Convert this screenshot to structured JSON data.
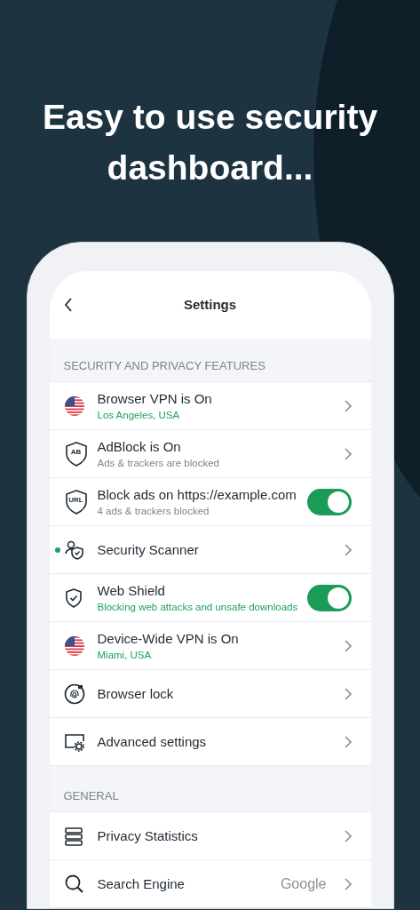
{
  "headline": "Easy to use security dashboard...",
  "screen": {
    "title": "Settings",
    "sections": [
      {
        "heading": "SECURITY AND PRIVACY FEATURES",
        "rows": [
          {
            "kind": "chevron",
            "title": "Browser VPN is On",
            "subtitle": "Los Angeles, USA",
            "accent": true,
            "dot": false
          },
          {
            "kind": "chevron",
            "icon_text": "AB",
            "title": "AdBlock is On",
            "subtitle": "Ads & trackers are blocked",
            "accent": false,
            "dot": false
          },
          {
            "kind": "toggle",
            "icon_text": "URL",
            "title": "Block ads on https://example.com",
            "subtitle": "4 ads & trackers blocked",
            "accent": false,
            "on": true,
            "dot": false
          },
          {
            "kind": "chevron",
            "title": "Security Scanner",
            "dot": true
          },
          {
            "kind": "toggle",
            "title": "Web Shield",
            "subtitle": "Blocking web attacks and unsafe downloads",
            "accent": true,
            "on": true,
            "dot": false
          },
          {
            "kind": "chevron",
            "title": "Device-Wide VPN is On",
            "subtitle": "Miami, USA",
            "accent": true,
            "dot": false
          },
          {
            "kind": "chevron",
            "title": "Browser lock",
            "dot": false
          },
          {
            "kind": "chevron",
            "title": "Advanced settings",
            "dot": false
          }
        ]
      },
      {
        "heading": "GENERAL",
        "rows": [
          {
            "kind": "chevron",
            "title": "Privacy Statistics",
            "dot": false
          },
          {
            "kind": "value",
            "title": "Search Engine",
            "value": "Google",
            "dot": false
          }
        ]
      }
    ]
  }
}
